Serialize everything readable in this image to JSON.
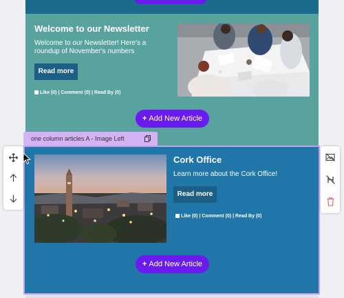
{
  "newsletter_section": {
    "title": "Welcome to our Newsletter",
    "text": "Welcome to our Newsletter! Here's a roundup of November's numbers",
    "read_more": "Read more",
    "meta": "Like (0) | Comment (0) | Read By (0)",
    "image": "office-meeting-photo"
  },
  "add_article_label": "Add New Article",
  "selected_block": {
    "tag_label": "one column articles A - Image Left",
    "title": "Cork Office",
    "text": "Learn more about the Cork Office!",
    "read_more": "Read more",
    "meta": "Like (0) | Comment (0) | Read By (0)",
    "image": "cork-city-photo"
  },
  "left_toolbar": [
    "move-icon",
    "arrow-up-icon",
    "arrow-down-icon"
  ],
  "right_toolbar": [
    "hide-image-icon",
    "hide-heading-icon",
    "delete-icon"
  ],
  "colors": {
    "teal_section": "#59a39f",
    "blue_section": "#2076a8",
    "purple_button": "#6a1cf0",
    "read_more_button": "#1c5f86",
    "selection_border": "#c4a2ef",
    "tag_background": "#d4b3f5",
    "delete_red": "#e05a5a"
  }
}
